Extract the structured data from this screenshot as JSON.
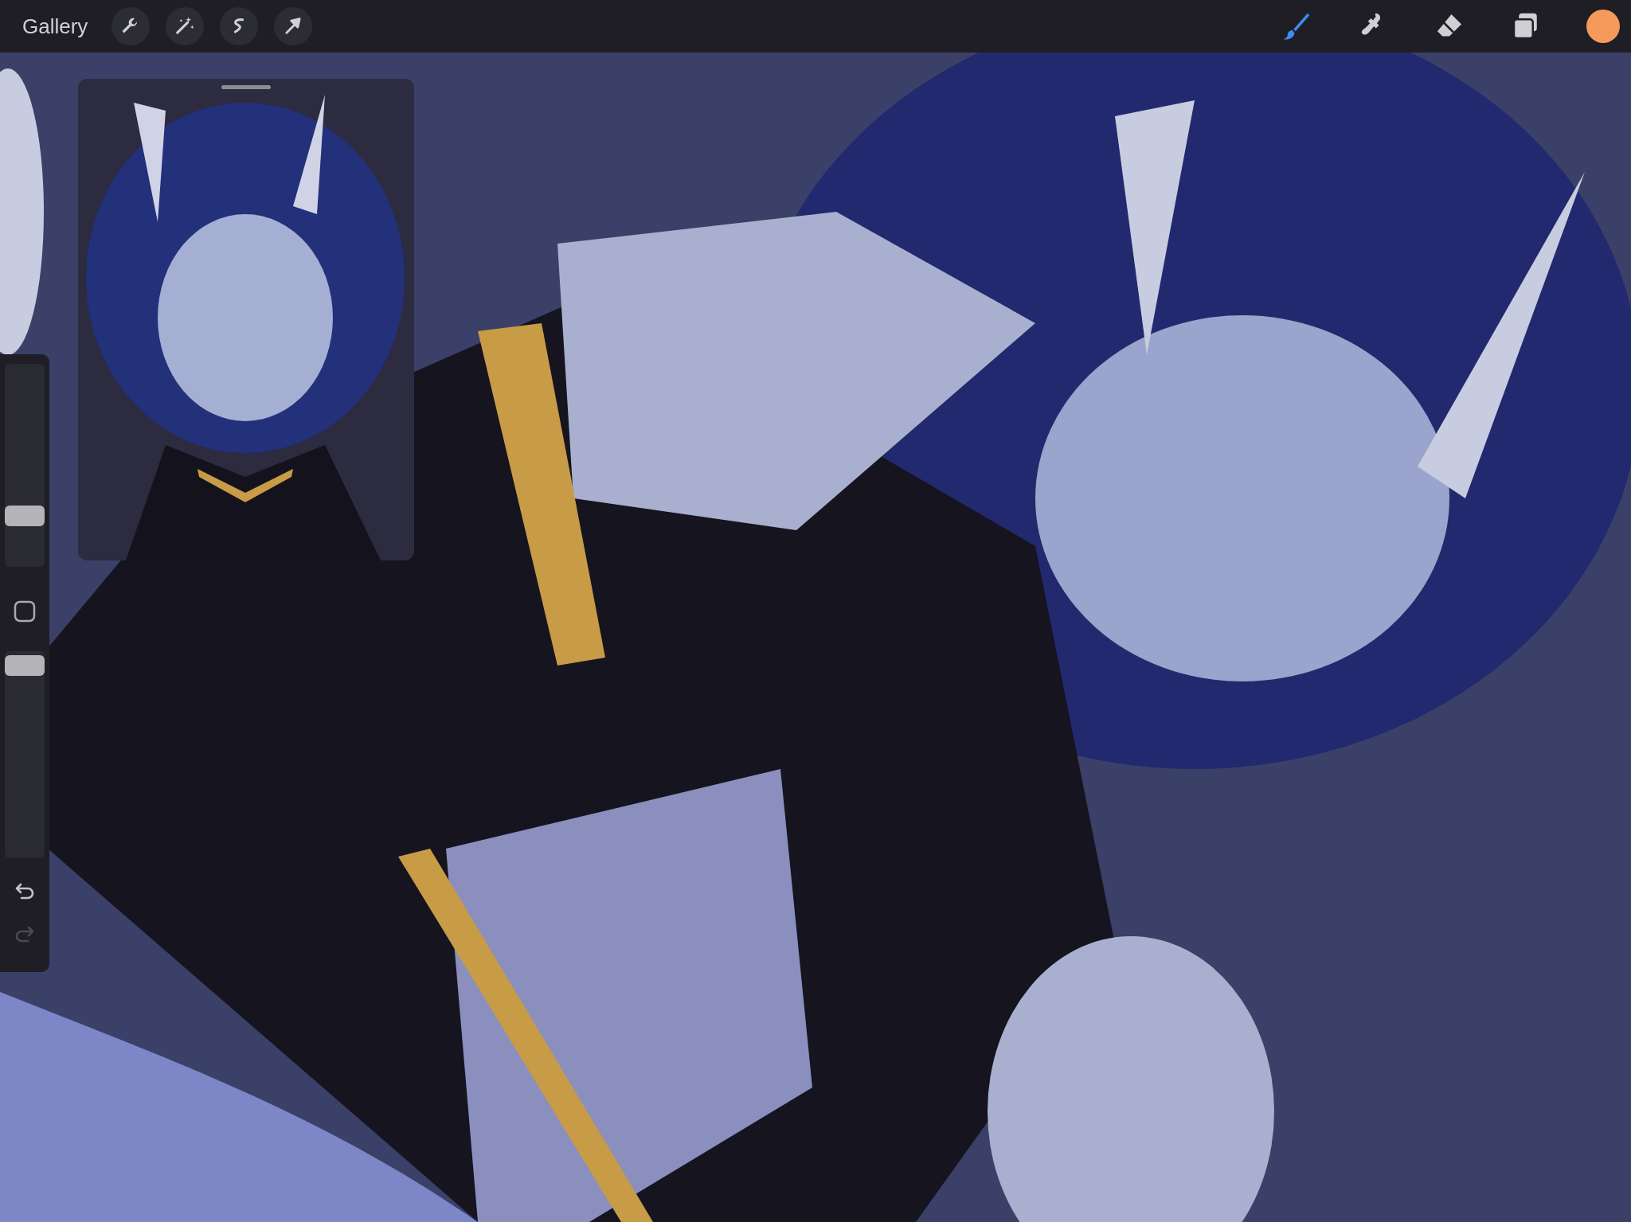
{
  "toolbar": {
    "gallery": "Gallery",
    "actions": [
      {
        "kind": "wrench"
      },
      {
        "kind": "wand"
      },
      {
        "kind": "selection"
      },
      {
        "kind": "transform"
      }
    ],
    "tools": [
      {
        "kind": "brush",
        "selected": true
      },
      {
        "kind": "smudge",
        "selected": false
      },
      {
        "kind": "eraser",
        "selected": false
      },
      {
        "kind": "layers",
        "selected": false
      }
    ],
    "color": {
      "color": "#f59a5a"
    }
  },
  "sidebar": {
    "size_slider": {
      "level": 0.25
    },
    "opacity_slider": {
      "level": 0.93
    },
    "undo": {
      "disabled": false
    },
    "redo": {
      "disabled": true
    }
  }
}
